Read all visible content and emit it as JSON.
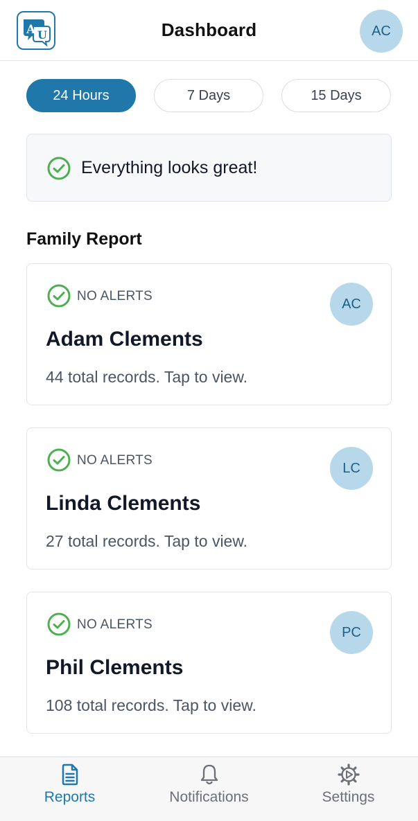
{
  "header": {
    "title": "Dashboard",
    "user_initials": "AC",
    "logo_icon": "au-logo-icon"
  },
  "ranges": [
    {
      "label": "24 Hours",
      "active": true
    },
    {
      "label": "7 Days",
      "active": false
    },
    {
      "label": "15 Days",
      "active": false
    }
  ],
  "status": {
    "icon": "check-circle-icon",
    "text": "Everything looks great!"
  },
  "family_report": {
    "title": "Family Report",
    "members": [
      {
        "alert": "NO ALERTS",
        "name": "Adam Clements",
        "records": "44 total records. Tap to view.",
        "initials": "AC"
      },
      {
        "alert": "NO ALERTS",
        "name": "Linda Clements",
        "records": "27 total records. Tap to view.",
        "initials": "LC"
      },
      {
        "alert": "NO ALERTS",
        "name": "Phil Clements",
        "records": "108 total records. Tap to view.",
        "initials": "PC"
      }
    ]
  },
  "bottom_nav": {
    "items": [
      {
        "label": "Reports",
        "icon": "document-icon",
        "active": true
      },
      {
        "label": "Notifications",
        "icon": "bell-icon",
        "active": false
      },
      {
        "label": "Settings",
        "icon": "gear-icon",
        "active": false
      }
    ]
  },
  "colors": {
    "accent": "#1f77aa",
    "success": "#4caf50",
    "avatar_bg": "#b7d8ea",
    "avatar_text": "#1f5f86"
  }
}
